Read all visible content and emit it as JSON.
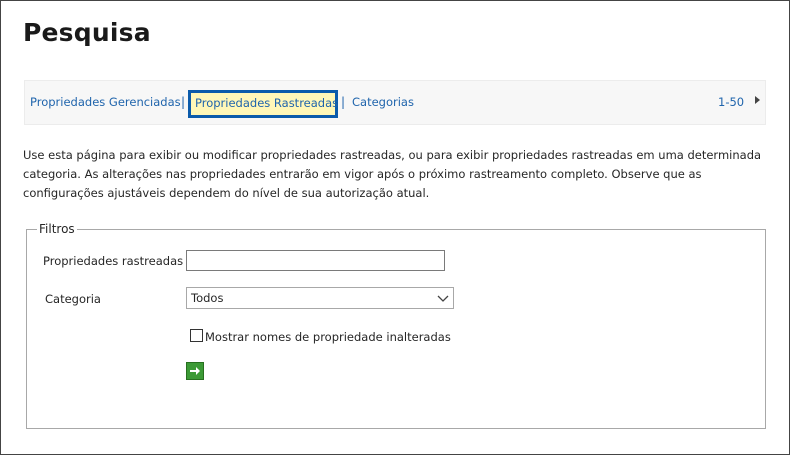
{
  "page": {
    "title": "Pesquisa"
  },
  "nav": {
    "managed_properties": "Propriedades Gerenciadas",
    "crawled_properties": "Propriedades Rastreadas",
    "categories": "Categorias",
    "separator": "|",
    "paging": "1-50",
    "paging_next_icon": "triangle-right-icon",
    "active_highlight_color": "#fff7b8",
    "active_border_color": "#0b5bab",
    "link_color": "#1f64ac"
  },
  "description": "Use esta página para exibir ou modificar propriedades rastreadas, ou para exibir propriedades rastreadas em uma determinada categoria. As alterações nas propriedades entrarão em vigor após o próximo rastreamento completo. Observe que as configurações ajustáveis dependem do nível de sua autorização atual.",
  "filters": {
    "legend": "Filtros",
    "crawled_properties_label": "Propriedades rastreadas",
    "crawled_properties_value": "",
    "category_label": "Categoria",
    "category_value": "Todos",
    "show_unaltered_label": "Mostrar nomes de propriedade inalteradas",
    "show_unaltered_checked": false,
    "go_button_icon": "arrow-right-icon",
    "go_button_color": "#3c9a36"
  }
}
